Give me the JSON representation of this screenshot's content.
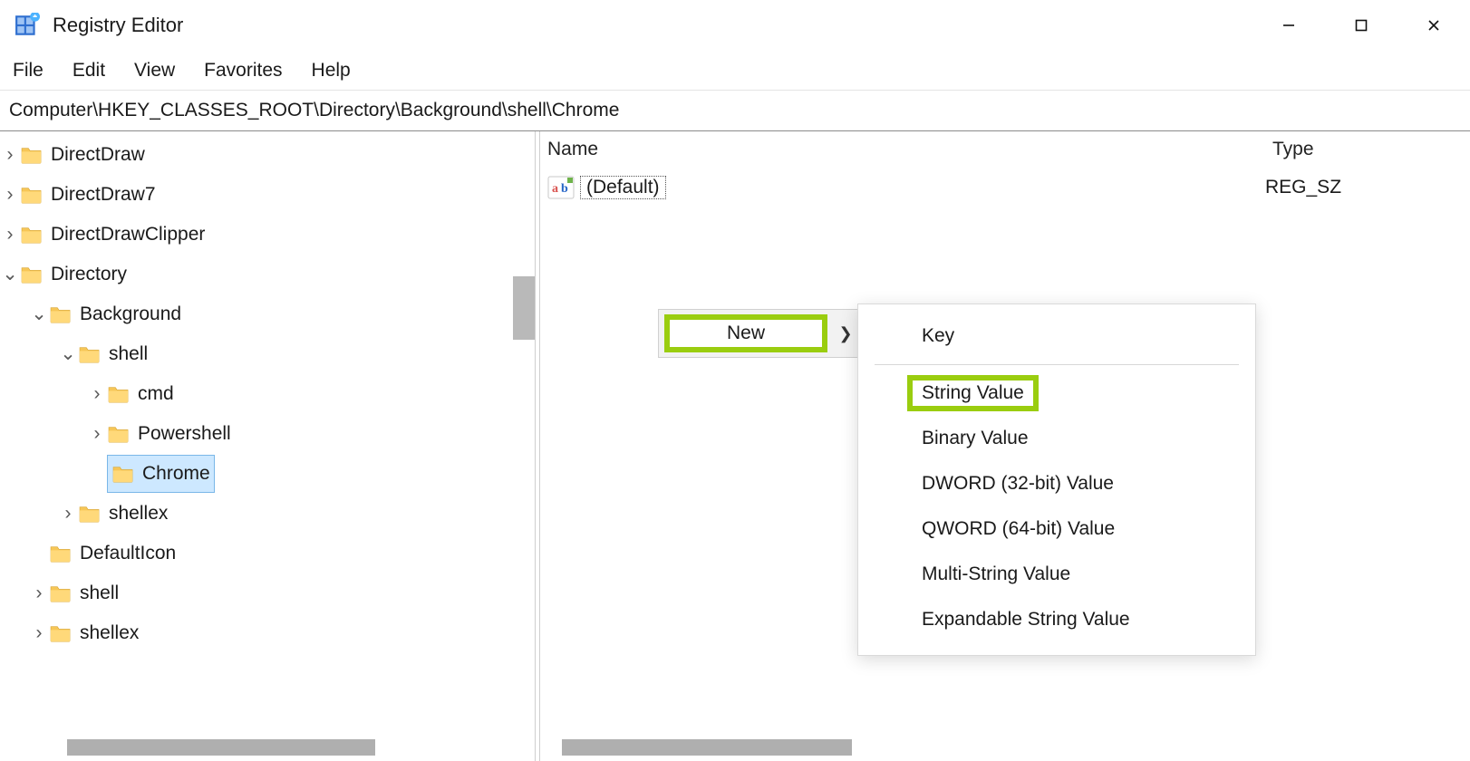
{
  "window": {
    "title": "Registry Editor"
  },
  "menubar": {
    "items": [
      "File",
      "Edit",
      "View",
      "Favorites",
      "Help"
    ]
  },
  "addressbar": {
    "path": "Computer\\HKEY_CLASSES_ROOT\\Directory\\Background\\shell\\Chrome"
  },
  "tree": {
    "items": [
      {
        "label": "DirectDraw",
        "depth": 0,
        "tw": "closed"
      },
      {
        "label": "DirectDraw7",
        "depth": 0,
        "tw": "closed"
      },
      {
        "label": "DirectDrawClipper",
        "depth": 0,
        "tw": "closed"
      },
      {
        "label": "Directory",
        "depth": 0,
        "tw": "open"
      },
      {
        "label": "Background",
        "depth": 1,
        "tw": "open"
      },
      {
        "label": "shell",
        "depth": 2,
        "tw": "open"
      },
      {
        "label": "cmd",
        "depth": 3,
        "tw": "closed"
      },
      {
        "label": "Powershell",
        "depth": 3,
        "tw": "closed"
      },
      {
        "label": "Chrome",
        "depth": 3,
        "tw": "none",
        "selected": true
      },
      {
        "label": "shellex",
        "depth": 2,
        "tw": "closed"
      },
      {
        "label": "DefaultIcon",
        "depth": 1,
        "tw": "none"
      },
      {
        "label": "shell",
        "depth": 1,
        "tw": "closed"
      },
      {
        "label": "shellex",
        "depth": 1,
        "tw": "closed"
      }
    ]
  },
  "list": {
    "columns": {
      "name": "Name",
      "type": "Type"
    },
    "rows": [
      {
        "name": "(Default)",
        "type": "REG_SZ"
      }
    ]
  },
  "context_menu": {
    "parent_label": "New",
    "items": [
      {
        "label": "Key"
      },
      {
        "separator": true
      },
      {
        "label": "String Value",
        "highlighted": true
      },
      {
        "label": "Binary Value"
      },
      {
        "label": "DWORD (32-bit) Value"
      },
      {
        "label": "QWORD (64-bit) Value"
      },
      {
        "label": "Multi-String Value"
      },
      {
        "label": "Expandable String Value"
      }
    ]
  }
}
